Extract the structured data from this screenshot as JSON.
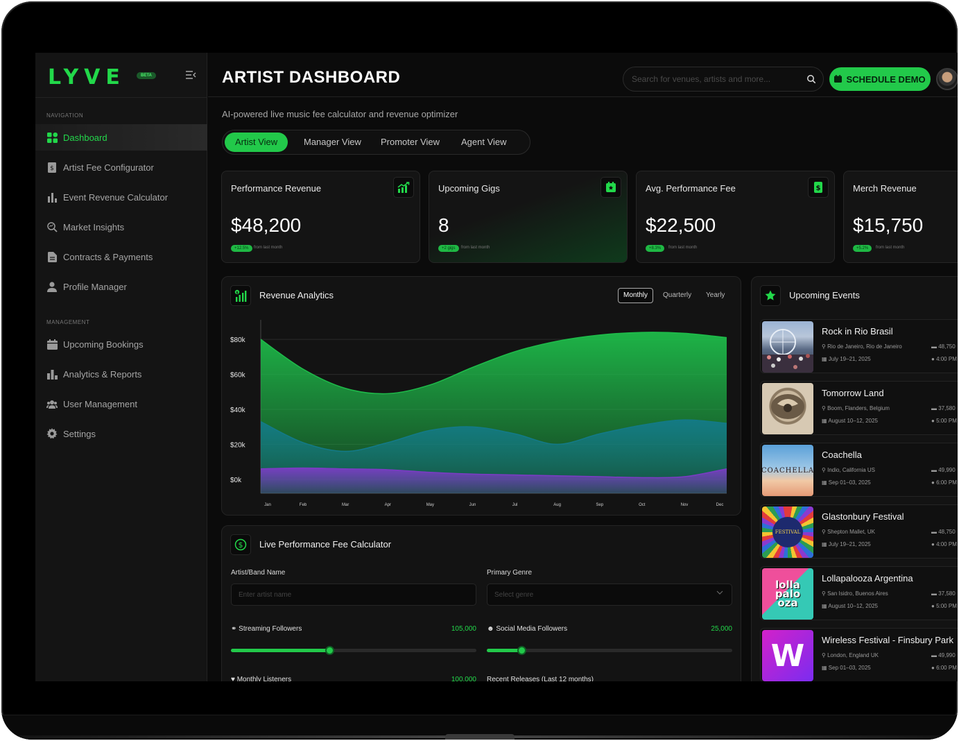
{
  "sidebar": {
    "logo": "LYVE",
    "beta": "BETA",
    "nav_heading": "NAVIGATION",
    "management_heading": "MANAGEMENT",
    "nav_items": [
      {
        "label": "Dashboard",
        "icon": "grid-icon",
        "active": true
      },
      {
        "label": "Artist Fee Configurator",
        "icon": "dollar-doc-icon"
      },
      {
        "label": "Event Revenue Calculator",
        "icon": "bar-chart-icon"
      },
      {
        "label": "Market Insights",
        "icon": "search-chart-icon"
      },
      {
        "label": "Contracts & Payments",
        "icon": "document-icon"
      },
      {
        "label": "Profile Manager",
        "icon": "user-icon"
      }
    ],
    "management_items": [
      {
        "label": "Upcoming Bookings",
        "icon": "calendar-icon"
      },
      {
        "label": "Analytics & Reports",
        "icon": "analytics-icon"
      },
      {
        "label": "User Management",
        "icon": "users-icon"
      },
      {
        "label": "Settings",
        "icon": "gear-icon"
      }
    ]
  },
  "header": {
    "title": "ARTIST DASHBOARD",
    "search_placeholder": "Search for venues, artists and more...",
    "demo_button": "SCHEDULE DEMO"
  },
  "subtitle": "AI-powered live music fee calculator and revenue optimizer",
  "tabs": [
    "Artist View",
    "Manager View",
    "Promoter View",
    "Agent View"
  ],
  "kpis": [
    {
      "label": "Performance Revenue",
      "value": "$48,200",
      "badge": "+12.5%",
      "note": "from last month",
      "icon": "trend-up-icon"
    },
    {
      "label": "Upcoming Gigs",
      "value": "8",
      "badge": "+2 gigs",
      "note": "from last month",
      "icon": "calendar-star-icon"
    },
    {
      "label": "Avg. Performance Fee",
      "value": "$22,500",
      "badge": "+8.3%",
      "note": "from last month",
      "icon": "dollar-icon"
    },
    {
      "label": "Merch Revenue",
      "value": "$15,750",
      "badge": "+5.2%",
      "note": "from last month",
      "icon": "bag-icon"
    }
  ],
  "analytics": {
    "title": "Revenue Analytics",
    "periods": [
      "Monthly",
      "Quarterly",
      "Yearly"
    ],
    "active_period": "Monthly"
  },
  "chart_data": {
    "type": "area",
    "title": "Revenue Analytics",
    "categories": [
      "Jan",
      "Feb",
      "Mar",
      "Apr",
      "May",
      "Jun",
      "Jul",
      "Aug",
      "Sep",
      "Oct",
      "Nov",
      "Dec"
    ],
    "y_ticks": [
      "$80k",
      "$60k",
      "$40k",
      "$20k",
      "$0k"
    ],
    "ylim": [
      -8000,
      88000
    ],
    "grid": true,
    "series": [
      {
        "values": [
          80000,
          63000,
          52000,
          49000,
          54000,
          64000,
          73000,
          79000,
          82500,
          84000,
          83500,
          81000
        ],
        "color": "#1ebc4a"
      },
      {
        "values": [
          33000,
          21000,
          16000,
          21000,
          28000,
          30000,
          26000,
          20000,
          26000,
          31000,
          34000,
          32000
        ],
        "color": "#137a88"
      },
      {
        "values": [
          6000,
          6500,
          6000,
          5500,
          4000,
          3000,
          2500,
          2000,
          1500,
          1000,
          1500,
          6000
        ],
        "color": "#7b3cc4"
      }
    ]
  },
  "calculator": {
    "title": "Live Performance Fee Calculator",
    "artist_label": "Artist/Band Name",
    "artist_placeholder": "Enter artist name",
    "genre_label": "Primary Genre",
    "genre_placeholder": "Select genre",
    "streaming_label": "Streaming Followers",
    "streaming_value": "105,000",
    "streaming_fraction": 0.4,
    "social_label": "Social Media Followers",
    "social_value": "25,000",
    "social_fraction": 0.14,
    "monthly_label": "Monthly Listeners",
    "monthly_value": "100,000",
    "releases_label": "Recent Releases (Last 12 months)"
  },
  "events": {
    "title": "Upcoming Events",
    "items": [
      {
        "name": "Rock in Rio Brasil",
        "location": "Rio de Janeiro, Rio de Janeiro",
        "date": "July 19–21, 2025",
        "capacity": "48,750",
        "time": "4:00 PM"
      },
      {
        "name": "Tomorrow Land",
        "location": "Boom, Flanders, Belgium",
        "date": "August 10–12, 2025",
        "capacity": "37,580",
        "time": "5:00 PM"
      },
      {
        "name": "Coachella",
        "location": "Indio, California US",
        "date": "Sep 01–03, 2025",
        "capacity": "49,990",
        "time": "6:00 PM",
        "thumb_text": "COACHELLA"
      },
      {
        "name": "Glastonbury Festival",
        "location": "Shepton Mallet, UK",
        "date": "July 19–21, 2025",
        "capacity": "48,750",
        "time": "4:00 PM",
        "thumb_text": "FESTIVAL"
      },
      {
        "name": "Lollapalooza Argentina",
        "location": "San Isidro, Buenos Aires",
        "date": "August 10–12, 2025",
        "capacity": "37,580",
        "time": "5:00 PM",
        "thumb_text": "lolla palo oza"
      },
      {
        "name": "Wireless Festival - Finsbury Park",
        "location": "London, England UK",
        "date": "Sep 01–03, 2025",
        "capacity": "49,990",
        "time": "6:00 PM",
        "thumb_text": "W"
      }
    ]
  }
}
